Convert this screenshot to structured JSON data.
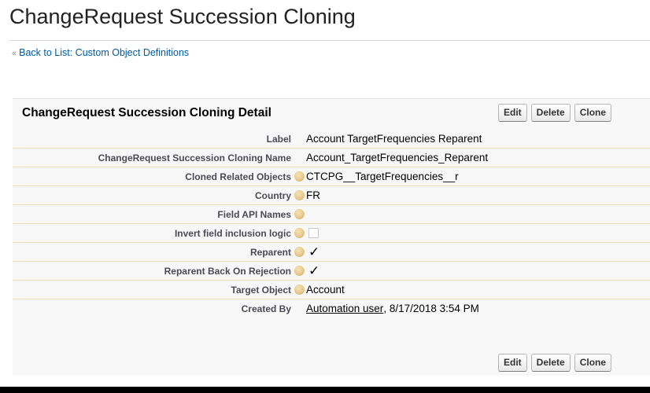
{
  "page": {
    "title": "ChangeRequest Succession Cloning",
    "breadcrumb_chevron": "«",
    "breadcrumb_link": "Back to List: Custom Object Definitions"
  },
  "detail": {
    "title": "ChangeRequest Succession Cloning Detail",
    "buttons": {
      "edit": "Edit",
      "delete": "Delete",
      "clone": "Clone"
    },
    "fields": {
      "label": {
        "label": "Label",
        "value": "Account TargetFrequencies Reparent"
      },
      "name": {
        "label": "ChangeRequest Succession Cloning Name",
        "value": "Account_TargetFrequencies_Reparent"
      },
      "cloned_related": {
        "label": "Cloned Related Objects",
        "value": "CTCPG__TargetFrequencies__r"
      },
      "country": {
        "label": "Country",
        "value": "FR"
      },
      "field_api_names": {
        "label": "Field API Names",
        "value": ""
      },
      "invert_logic": {
        "label": "Invert field inclusion logic",
        "checked": false
      },
      "reparent": {
        "label": "Reparent",
        "checked": true,
        "mark": "✓"
      },
      "reparent_rejection": {
        "label": "Reparent Back On Rejection",
        "checked": true,
        "mark": "✓"
      },
      "target_object": {
        "label": "Target Object",
        "value": "Account"
      },
      "created_by": {
        "label": "Created By",
        "user": "Automation user",
        "date": ", 8/17/2018 3:54 PM"
      }
    }
  },
  "colors": {
    "link": "#015ba7",
    "label_text": "#4a4a56",
    "row_divider": "#e3deb8",
    "help_icon": "#dcb36e"
  }
}
